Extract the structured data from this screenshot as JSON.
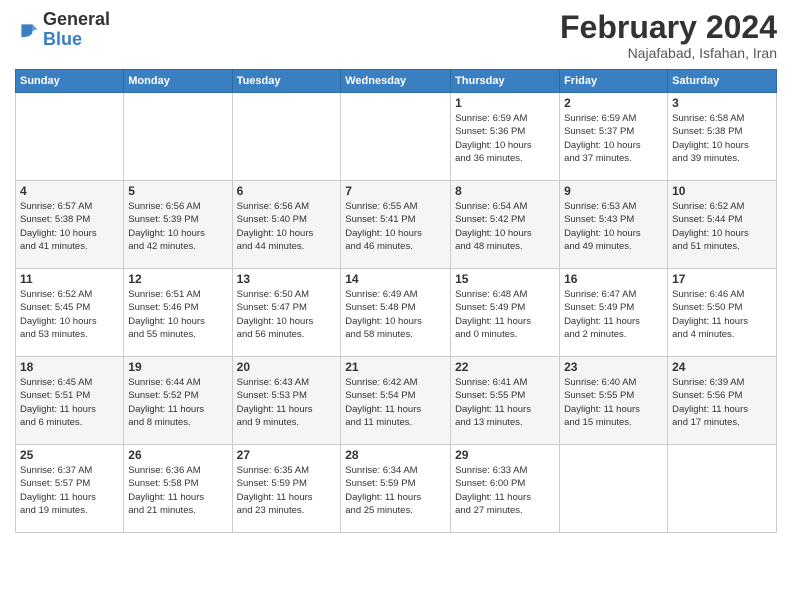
{
  "logo": {
    "general": "General",
    "blue": "Blue"
  },
  "header": {
    "month": "February 2024",
    "location": "Najafabad, Isfahan, Iran"
  },
  "weekdays": [
    "Sunday",
    "Monday",
    "Tuesday",
    "Wednesday",
    "Thursday",
    "Friday",
    "Saturday"
  ],
  "weeks": [
    [
      {
        "day": "",
        "info": ""
      },
      {
        "day": "",
        "info": ""
      },
      {
        "day": "",
        "info": ""
      },
      {
        "day": "",
        "info": ""
      },
      {
        "day": "1",
        "info": "Sunrise: 6:59 AM\nSunset: 5:36 PM\nDaylight: 10 hours\nand 36 minutes."
      },
      {
        "day": "2",
        "info": "Sunrise: 6:59 AM\nSunset: 5:37 PM\nDaylight: 10 hours\nand 37 minutes."
      },
      {
        "day": "3",
        "info": "Sunrise: 6:58 AM\nSunset: 5:38 PM\nDaylight: 10 hours\nand 39 minutes."
      }
    ],
    [
      {
        "day": "4",
        "info": "Sunrise: 6:57 AM\nSunset: 5:38 PM\nDaylight: 10 hours\nand 41 minutes."
      },
      {
        "day": "5",
        "info": "Sunrise: 6:56 AM\nSunset: 5:39 PM\nDaylight: 10 hours\nand 42 minutes."
      },
      {
        "day": "6",
        "info": "Sunrise: 6:56 AM\nSunset: 5:40 PM\nDaylight: 10 hours\nand 44 minutes."
      },
      {
        "day": "7",
        "info": "Sunrise: 6:55 AM\nSunset: 5:41 PM\nDaylight: 10 hours\nand 46 minutes."
      },
      {
        "day": "8",
        "info": "Sunrise: 6:54 AM\nSunset: 5:42 PM\nDaylight: 10 hours\nand 48 minutes."
      },
      {
        "day": "9",
        "info": "Sunrise: 6:53 AM\nSunset: 5:43 PM\nDaylight: 10 hours\nand 49 minutes."
      },
      {
        "day": "10",
        "info": "Sunrise: 6:52 AM\nSunset: 5:44 PM\nDaylight: 10 hours\nand 51 minutes."
      }
    ],
    [
      {
        "day": "11",
        "info": "Sunrise: 6:52 AM\nSunset: 5:45 PM\nDaylight: 10 hours\nand 53 minutes."
      },
      {
        "day": "12",
        "info": "Sunrise: 6:51 AM\nSunset: 5:46 PM\nDaylight: 10 hours\nand 55 minutes."
      },
      {
        "day": "13",
        "info": "Sunrise: 6:50 AM\nSunset: 5:47 PM\nDaylight: 10 hours\nand 56 minutes."
      },
      {
        "day": "14",
        "info": "Sunrise: 6:49 AM\nSunset: 5:48 PM\nDaylight: 10 hours\nand 58 minutes."
      },
      {
        "day": "15",
        "info": "Sunrise: 6:48 AM\nSunset: 5:49 PM\nDaylight: 11 hours\nand 0 minutes."
      },
      {
        "day": "16",
        "info": "Sunrise: 6:47 AM\nSunset: 5:49 PM\nDaylight: 11 hours\nand 2 minutes."
      },
      {
        "day": "17",
        "info": "Sunrise: 6:46 AM\nSunset: 5:50 PM\nDaylight: 11 hours\nand 4 minutes."
      }
    ],
    [
      {
        "day": "18",
        "info": "Sunrise: 6:45 AM\nSunset: 5:51 PM\nDaylight: 11 hours\nand 6 minutes."
      },
      {
        "day": "19",
        "info": "Sunrise: 6:44 AM\nSunset: 5:52 PM\nDaylight: 11 hours\nand 8 minutes."
      },
      {
        "day": "20",
        "info": "Sunrise: 6:43 AM\nSunset: 5:53 PM\nDaylight: 11 hours\nand 9 minutes."
      },
      {
        "day": "21",
        "info": "Sunrise: 6:42 AM\nSunset: 5:54 PM\nDaylight: 11 hours\nand 11 minutes."
      },
      {
        "day": "22",
        "info": "Sunrise: 6:41 AM\nSunset: 5:55 PM\nDaylight: 11 hours\nand 13 minutes."
      },
      {
        "day": "23",
        "info": "Sunrise: 6:40 AM\nSunset: 5:55 PM\nDaylight: 11 hours\nand 15 minutes."
      },
      {
        "day": "24",
        "info": "Sunrise: 6:39 AM\nSunset: 5:56 PM\nDaylight: 11 hours\nand 17 minutes."
      }
    ],
    [
      {
        "day": "25",
        "info": "Sunrise: 6:37 AM\nSunset: 5:57 PM\nDaylight: 11 hours\nand 19 minutes."
      },
      {
        "day": "26",
        "info": "Sunrise: 6:36 AM\nSunset: 5:58 PM\nDaylight: 11 hours\nand 21 minutes."
      },
      {
        "day": "27",
        "info": "Sunrise: 6:35 AM\nSunset: 5:59 PM\nDaylight: 11 hours\nand 23 minutes."
      },
      {
        "day": "28",
        "info": "Sunrise: 6:34 AM\nSunset: 5:59 PM\nDaylight: 11 hours\nand 25 minutes."
      },
      {
        "day": "29",
        "info": "Sunrise: 6:33 AM\nSunset: 6:00 PM\nDaylight: 11 hours\nand 27 minutes."
      },
      {
        "day": "",
        "info": ""
      },
      {
        "day": "",
        "info": ""
      }
    ]
  ]
}
